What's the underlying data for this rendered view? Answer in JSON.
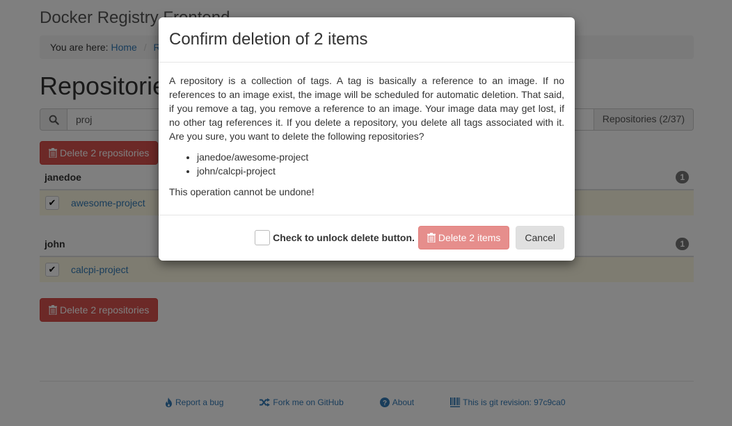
{
  "app": {
    "title": "Docker Registry Frontend"
  },
  "breadcrumb": {
    "prefix": "You are here:",
    "items": [
      "Home",
      "Repositories"
    ]
  },
  "page": {
    "title": "Repositories"
  },
  "search": {
    "value": "proj",
    "count_label": "Repositories (2/37)",
    "icon": "search-icon"
  },
  "actions": {
    "delete_label": "Delete 2 repositories",
    "icon": "trash-icon"
  },
  "groups": [
    {
      "owner": "janedoe",
      "count": "1",
      "repos": [
        {
          "name": "awesome-project",
          "checked": true
        }
      ]
    },
    {
      "owner": "john",
      "count": "1",
      "repos": [
        {
          "name": "calcpi-project",
          "checked": true
        }
      ]
    }
  ],
  "footer": {
    "links": [
      {
        "label": "Report a bug",
        "icon": "fire-icon"
      },
      {
        "label": "Fork me on GitHub",
        "icon": "shuffle-icon"
      },
      {
        "label": "About",
        "icon": "question-circle-icon"
      },
      {
        "label": "This is git revision: 97c9ca0",
        "icon": "barcode-icon"
      }
    ]
  },
  "modal": {
    "title": "Confirm deletion of 2 items",
    "description": "A repository is a collection of tags. A tag is basically a reference to an image. If no references to an image exist, the image will be scheduled for automatic deletion. That said, if you remove a tag, you remove a reference to an image. Your image data may get lost, if no other tag references it. If you delete a repository, you delete all tags associated with it. Are you sure, you want to delete the following repositories?",
    "items": [
      "janedoe/awesome-project",
      "john/calcpi-project"
    ],
    "warning": "This operation cannot be undone!",
    "unlock_label": "Check to unlock delete button.",
    "unlock_checked": false,
    "delete_label": "Delete 2 items",
    "delete_disabled": true,
    "cancel_label": "Cancel"
  },
  "colors": {
    "danger": "#d9534f",
    "link": "#337ab7",
    "selected_row": "#fcf8e3"
  }
}
